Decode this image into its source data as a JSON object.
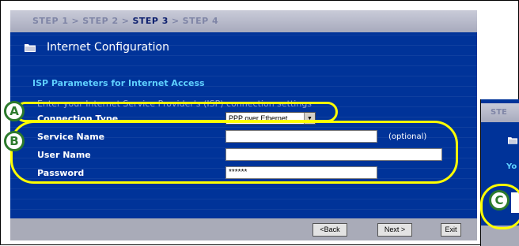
{
  "steps": {
    "step1": "STEP 1",
    "step2": "STEP 2",
    "step3": "STEP 3",
    "step4": "STEP 4",
    "separator": ">"
  },
  "page_title": "Internet Configuration",
  "section_title": "ISP Parameters for Internet Access",
  "intro_text": "Enter your Internet Service Provider's (ISP) connection settings",
  "form": {
    "connection_type_label": "Connection Type",
    "connection_type_value": "PPP over Ethernet",
    "service_name_label": "Service Name",
    "service_name_value": "",
    "optional_text": "(optional)",
    "user_name_label": "User Name",
    "user_name_value": "",
    "password_label": "Password",
    "password_value": "******"
  },
  "buttons": {
    "back": "<Back",
    "next": "Next >",
    "exit": "Exit"
  },
  "callouts": {
    "a": "A",
    "b": "B",
    "c": "C"
  },
  "second_panel": {
    "steps_fragment": "STE",
    "text_fragment": "Yo"
  },
  "colors": {
    "panel_bg": "#003399",
    "section_heading": "#5fd0ff",
    "highlight": "#ffff00",
    "callout": "#2c7a2c"
  }
}
